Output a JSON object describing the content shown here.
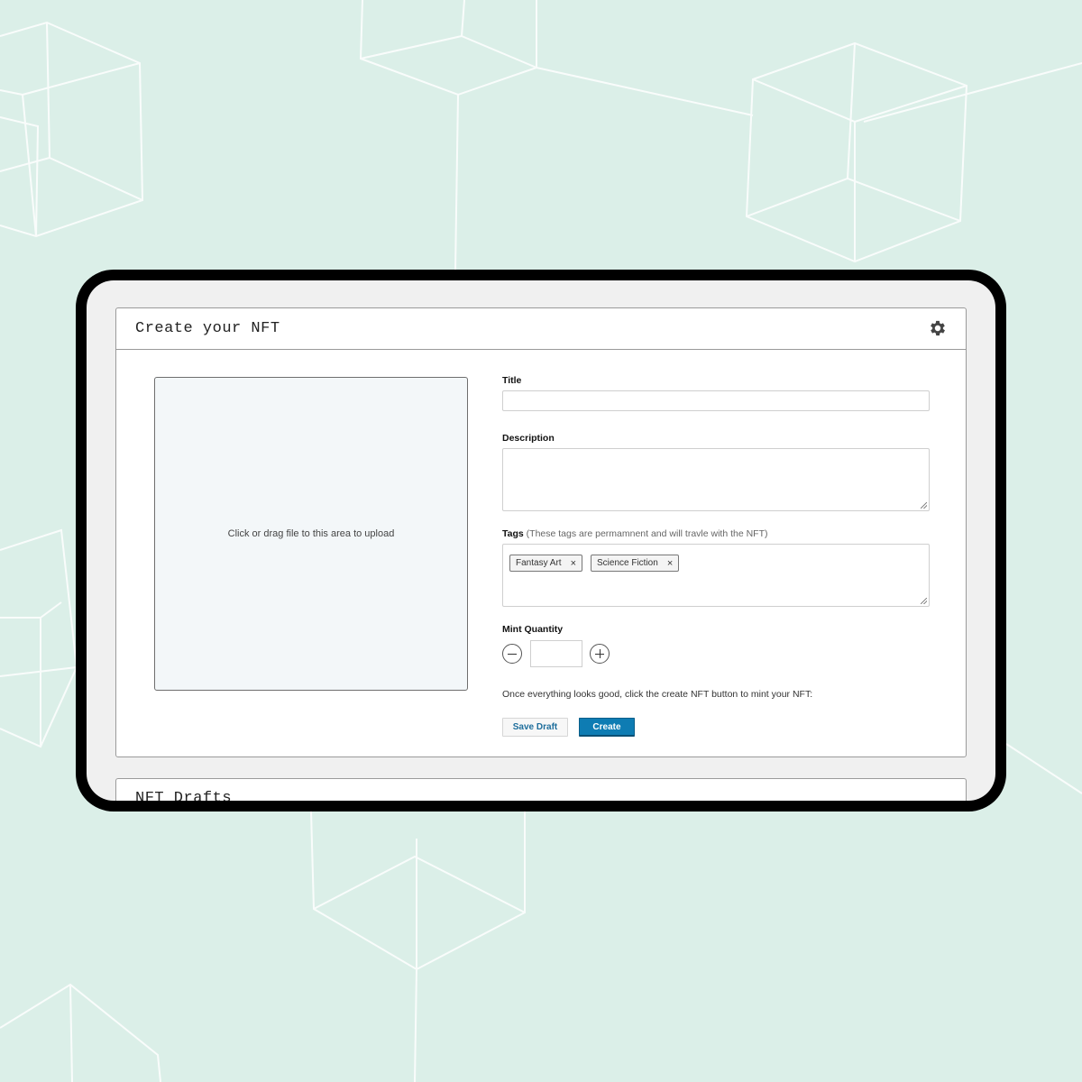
{
  "page": {
    "title": "Create your NFT",
    "settings_icon": "gear-icon"
  },
  "upload": {
    "prompt": "Click or drag file to this area to upload"
  },
  "form": {
    "title_label": "Title",
    "title_value": "",
    "description_label": "Description",
    "description_value": "",
    "tags_label": "Tags",
    "tags_hint": "(These tags are permamnent and will travle with the NFT)",
    "tags": [
      {
        "label": "Fantasy Art",
        "remove_icon": "close-icon"
      },
      {
        "label": "Science Fiction",
        "remove_icon": "close-icon"
      }
    ],
    "mint_quantity_label": "Mint Quantity",
    "mint_quantity_value": "",
    "decrement_icon": "minus-circle-icon",
    "increment_icon": "plus-circle-icon",
    "note": "Once everything looks good, click the create NFT button to mint your NFT:"
  },
  "actions": {
    "save_draft": "Save Draft",
    "create": "Create"
  },
  "drafts": {
    "title": "NFT Drafts"
  },
  "colors": {
    "background": "#dbefe8",
    "primary": "#0e7cb3",
    "link": "#1e6e9c"
  }
}
